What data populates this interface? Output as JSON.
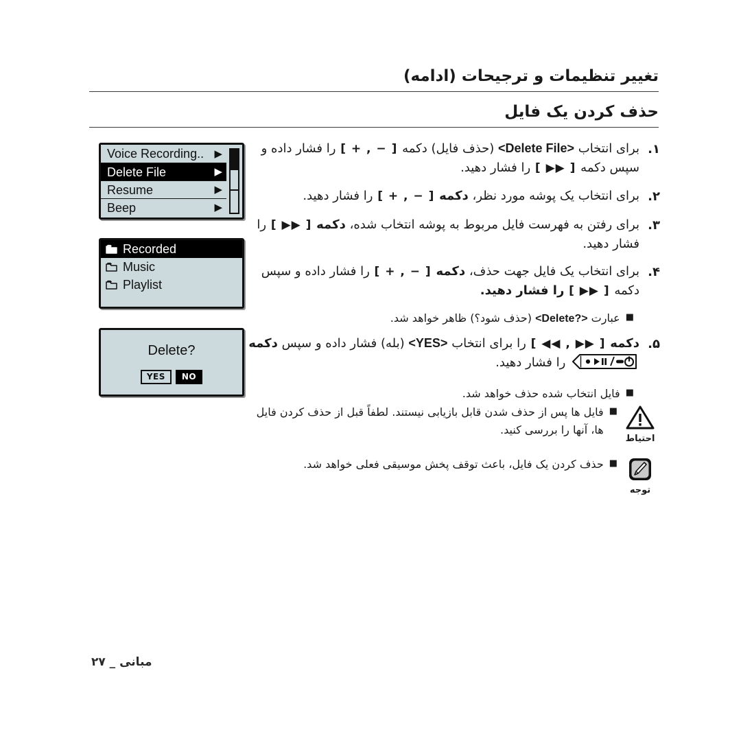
{
  "header": {
    "title": "تغییر تنظیمات و ترجیحات (ادامه)",
    "subtitle": "حذف کردن یک فایل"
  },
  "screens": {
    "menu": {
      "name": "settings-menu-screen",
      "rows": [
        {
          "label": "Voice Recording..",
          "arrow": "▶",
          "selected": false
        },
        {
          "label": "Delete File",
          "arrow": "▶",
          "selected": true
        },
        {
          "label": "Resume",
          "arrow": "▶",
          "selected": false
        },
        {
          "label": "Beep",
          "arrow": "▶",
          "selected": false
        }
      ],
      "scrollbar": "vertical-scrollbar"
    },
    "folders": {
      "name": "folder-list-screen",
      "rows": [
        {
          "label": "Recorded",
          "icon": "folder-icon",
          "selected": true
        },
        {
          "label": "Music",
          "icon": "folder-icon",
          "selected": false
        },
        {
          "label": "Playlist",
          "icon": "folder-icon",
          "selected": false
        }
      ]
    },
    "confirm": {
      "name": "delete-confirm-screen",
      "title": "Delete?",
      "yes_label": "YES",
      "no_label": "NO"
    }
  },
  "steps": [
    {
      "num": "۱.",
      "part1": "برای انتخاب",
      "english": "<Delete File>",
      "paren": "(حذف فایل)",
      "word_button": "دکمه",
      "key1": "[ + , − ]",
      "part2": "را فشار داده و سپس دکمه",
      "key2": "[ ▶▶ ]",
      "part3": "را فشار دهید."
    },
    {
      "num": "۲.",
      "part1": "برای انتخاب یک پوشه مورد نظر،",
      "word_button": "دکمه",
      "key1": "[ + , − ]",
      "part2": "را فشار دهید."
    },
    {
      "num": "۳.",
      "part1": "برای رفتن به فهرست فایل مربوط به پوشه انتخاب شده،",
      "word_button": "دکمه",
      "key1": "[ ▶▶ ]",
      "part2": "را فشار دهید."
    },
    {
      "num": "۴.",
      "part1": "برای انتخاب یک فایل جهت حذف،",
      "word_button": "دکمه",
      "key1": "[ + , − ]",
      "part2": "را فشار داده و سپس دکمه",
      "key2": "[ ▶▶ ]",
      "part3": "را فشار دهید.",
      "bullet": {
        "mark": "■",
        "pre": "عبارت",
        "english": "<Delete?>",
        "paren": "(حذف شود؟)",
        "post": "ظاهر خواهد شد."
      }
    },
    {
      "num": "۵.",
      "word_button": "دکمه",
      "key1": "[ ◀◀ , ▶▶ ]",
      "part1": "را برای انتخاب",
      "english": "<YES>",
      "paren": "(بله)",
      "part2": "فشار داده و سپس",
      "word_button2": "دکمه",
      "key_icon": "play-pause-power-button-icon",
      "part3": "را فشار دهید.",
      "bullet": {
        "mark": "■",
        "text": "فایل انتخاب شده حذف خواهد شد."
      }
    }
  ],
  "notices": [
    {
      "icon": "warning-triangle-icon",
      "icon_label": "احتیاط",
      "lines": [
        {
          "mark": "■",
          "text": "فایل ها پس از حذف شدن قابل بازیابی نیستند. لطفاً قبل از حذف کردن فایل ها، آنها را بررسی کنید."
        }
      ]
    },
    {
      "icon": "note-pencil-icon",
      "icon_label": "توجه",
      "lines": [
        {
          "mark": "■",
          "text": "حذف کردن یک فایل، باعث توقف پخش موسیقی فعلی خواهد شد."
        }
      ]
    }
  ],
  "footer": {
    "text": "مبانی _ ۲۷"
  },
  "colors": {
    "lcd_background": "#ccd9dd",
    "lcd_border": "#111111",
    "selected_row": "#000000",
    "page_background": "#ffffff",
    "text": "#1a1a1a"
  }
}
